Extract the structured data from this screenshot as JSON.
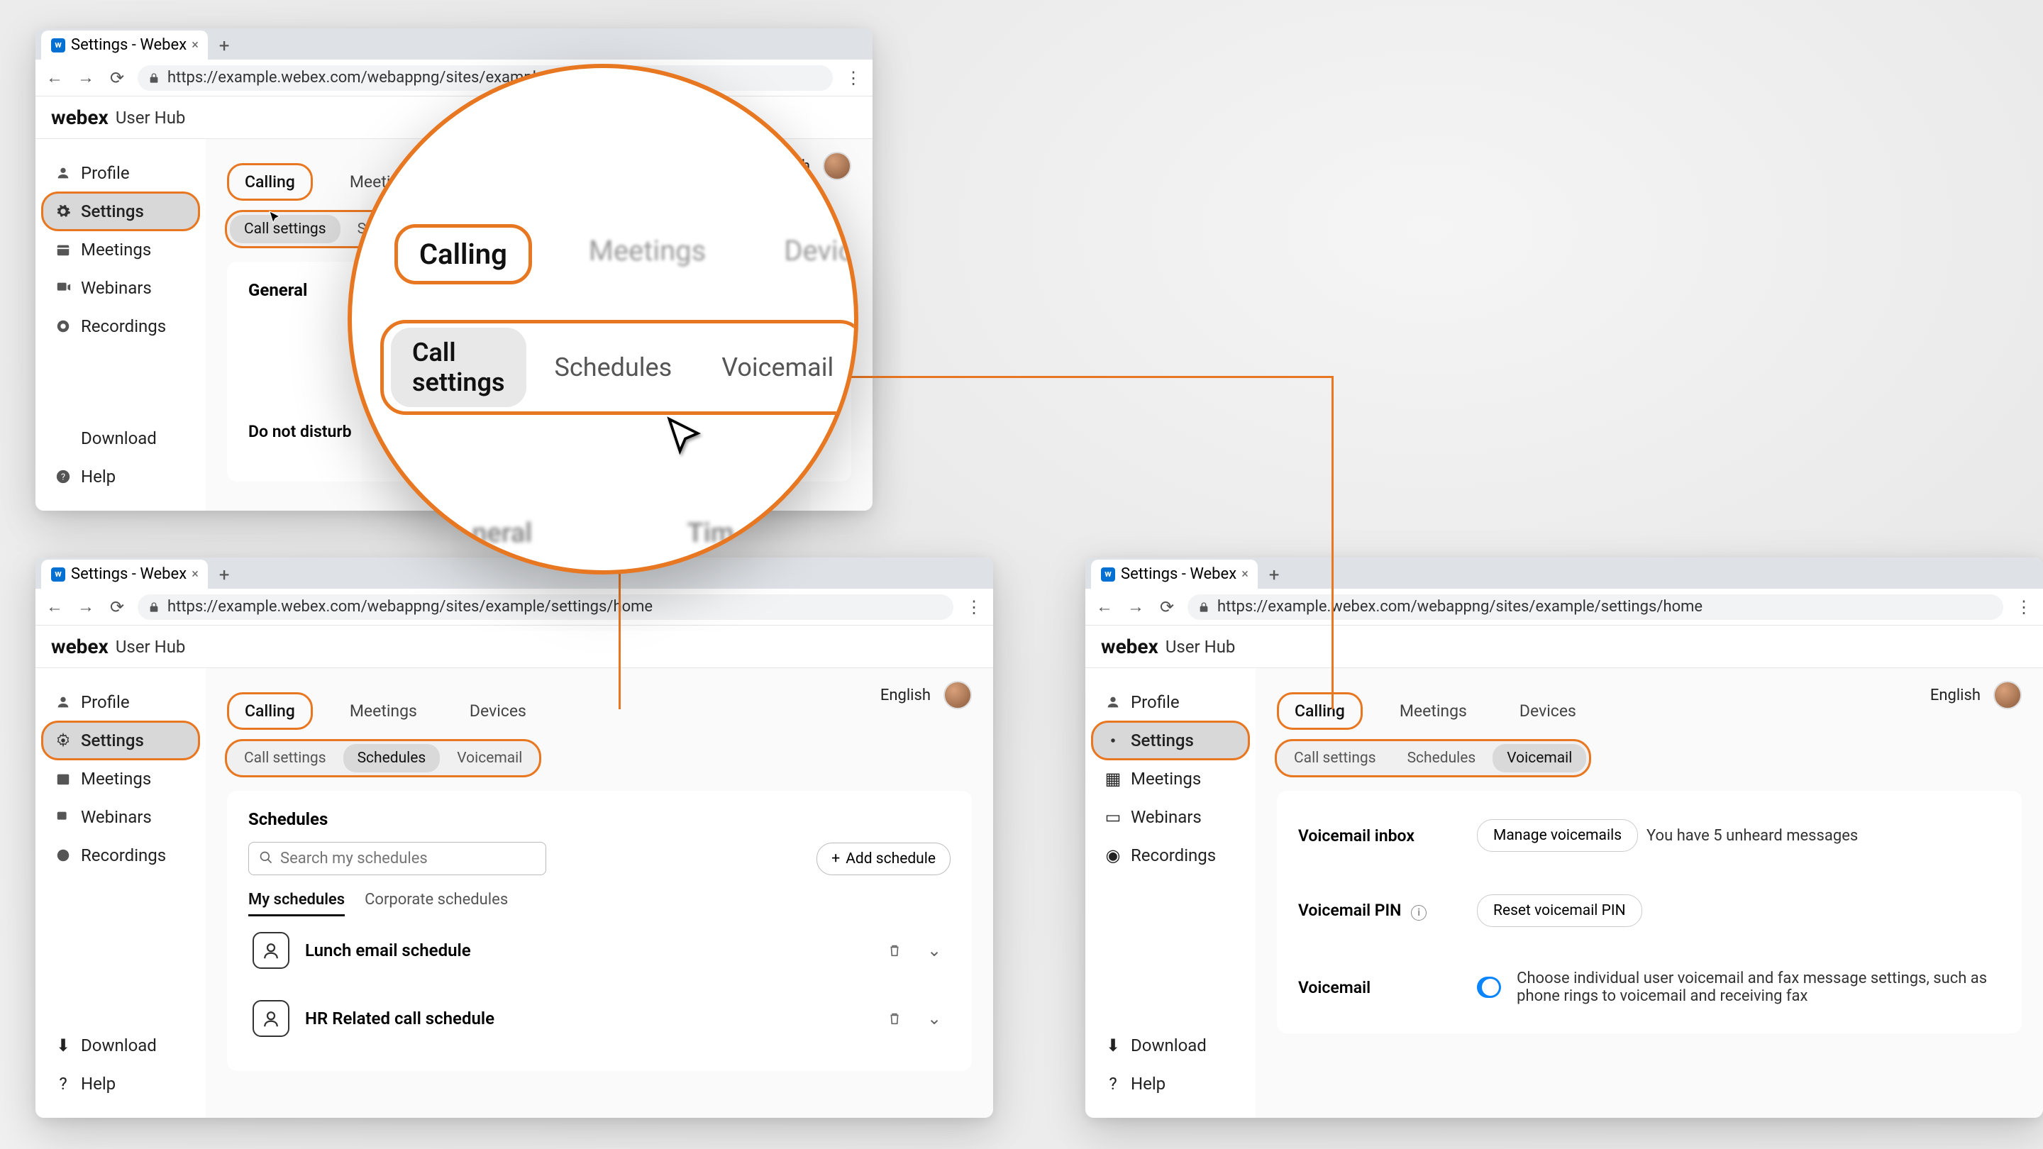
{
  "browser": {
    "tab_title": "Settings - Webex",
    "url": "https://example.webex.com/webappng/sites/example/settings/home"
  },
  "app": {
    "brand": "webex",
    "subbrand": "User Hub",
    "language": "English"
  },
  "sidebar": {
    "items": [
      {
        "label": "Profile"
      },
      {
        "label": "Settings"
      },
      {
        "label": "Meetings"
      },
      {
        "label": "Webinars"
      },
      {
        "label": "Recordings"
      }
    ],
    "bottom": [
      {
        "label": "Download"
      },
      {
        "label": "Help"
      }
    ]
  },
  "tabs_primary": [
    {
      "label": "Calling"
    },
    {
      "label": "Meetings"
    },
    {
      "label": "Devices"
    }
  ],
  "tabs_secondary": [
    {
      "label": "Call settings"
    },
    {
      "label": "Schedules"
    },
    {
      "label": "Voicemail"
    }
  ],
  "win1": {
    "panel_title": "General",
    "dnd_label": "Do not disturb"
  },
  "win2": {
    "panel_title": "Schedules",
    "search_placeholder": "Search my schedules",
    "add_button": "Add schedule",
    "subtabs": [
      {
        "label": "My schedules"
      },
      {
        "label": "Corporate schedules"
      }
    ],
    "schedules": [
      {
        "title": "Lunch email schedule"
      },
      {
        "title": "HR Related call schedule"
      }
    ]
  },
  "win3": {
    "inbox_label": "Voicemail inbox",
    "manage_btn": "Manage voicemails",
    "inbox_msg": "You have 5 unheard messages",
    "pin_label": "Voicemail PIN",
    "reset_btn": "Reset voicemail PIN",
    "vm_label": "Voicemail",
    "vm_desc": "Choose individual user voicemail and fax message settings, such as phone rings to voicemail and receiving fax"
  },
  "magnifier": {
    "primary": [
      "Calling",
      "Meetings",
      "Devices"
    ],
    "secondary": [
      "Call settings",
      "Schedules",
      "Voicemail"
    ],
    "blur_left": "neral",
    "blur_right": "Tim"
  }
}
